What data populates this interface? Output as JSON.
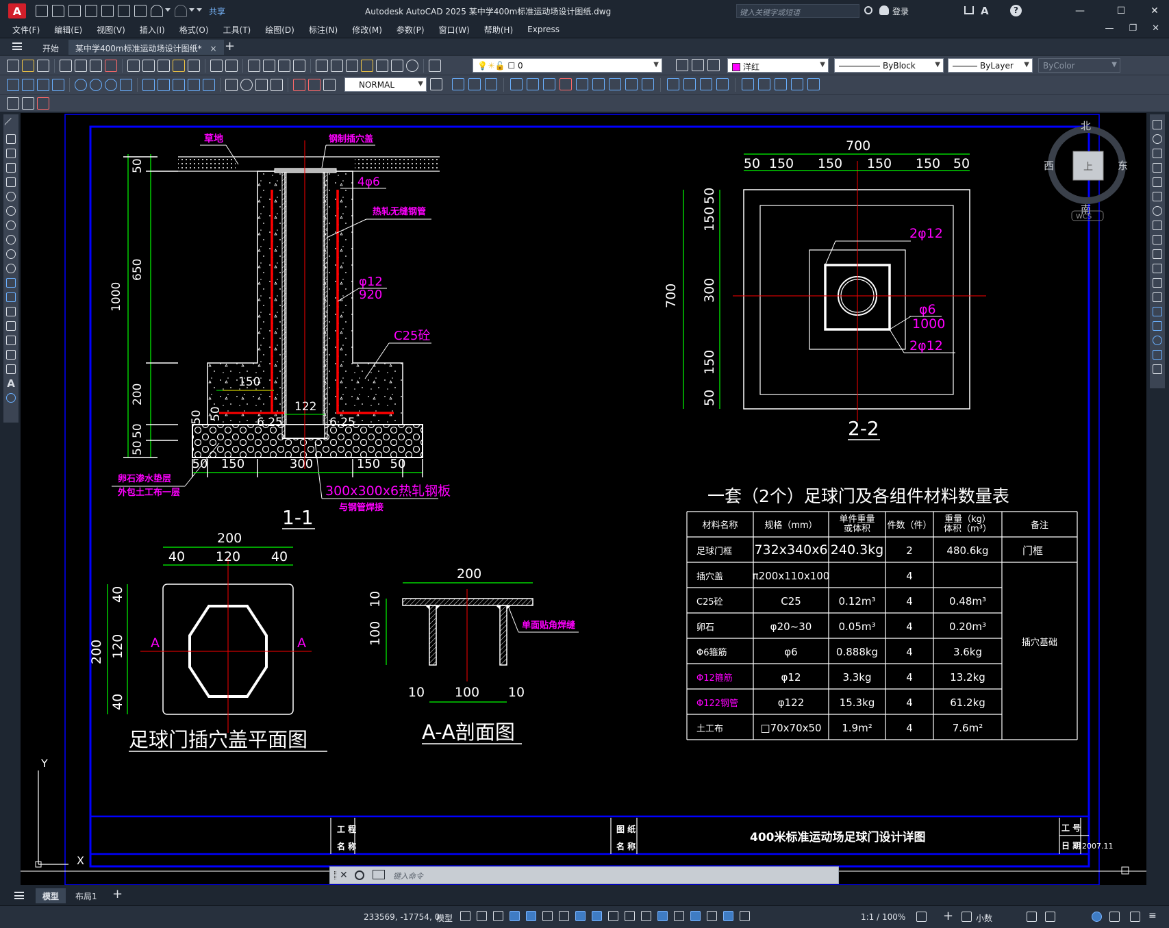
{
  "app": {
    "logo": "A",
    "title": "Autodesk AutoCAD 2025    某中学400m标准运动场设计图纸.dwg",
    "share_label": "共享",
    "search_placeholder": "键入关键字或短语",
    "login_label": "登录"
  },
  "menu": [
    "文件(F)",
    "编辑(E)",
    "视图(V)",
    "插入(I)",
    "格式(O)",
    "工具(T)",
    "绘图(D)",
    "标注(N)",
    "修改(M)",
    "参数(P)",
    "窗口(W)",
    "帮助(H)",
    "Express"
  ],
  "tabs": {
    "start": "开始",
    "drawing": "某中学400m标准运动场设计图纸*",
    "close": "×",
    "add": "+"
  },
  "toolbar": {
    "layer_value": "0",
    "color_value": "洋红",
    "linetype_value": "ByBlock",
    "lineweight_value": "ByLayer",
    "plotstyle_value": "ByColor",
    "dimstyle_value": "NORMAL"
  },
  "viewcube": {
    "north": "北",
    "south": "南",
    "east": "东",
    "west": "西",
    "face": "上",
    "wcs": "WCS"
  },
  "ucs": {
    "y": "Y",
    "x": "X"
  },
  "drawing": {
    "section11": {
      "title": "1-1",
      "label_grass": "草地",
      "label_cover": "钢制插穴盖",
      "label_4phi6": "4φ6",
      "label_pipe": "热轧无缝钢管",
      "label_phi12": "φ12",
      "label_920": "920",
      "label_c25": "C25砼",
      "label_gravel1": "卵石渗水垫层",
      "label_gravel2": "外包土工布一层",
      "label_plate1": "300x300x6热轧钢板",
      "label_plate2": "与钢管焊接",
      "dim_1000": "1000",
      "dim_50a": "50",
      "dim_650": "650",
      "dim_200": "200",
      "dim_50b": "50",
      "dim_50c": "50",
      "dim_50d": "50",
      "dim_150in": "150",
      "dim_122": "122",
      "dim_625a": "6.25",
      "dim_625b": "6.25",
      "dim_50e": "50",
      "bottom_dims": [
        "50",
        "150",
        "300",
        "150",
        "50"
      ]
    },
    "section22": {
      "title": "2-2",
      "dim_700_top": "700",
      "top_dims": [
        "50",
        "150",
        "150",
        "150",
        "150",
        "50"
      ],
      "dim_700_left": "700",
      "left_dims": [
        "50",
        "150",
        "300",
        "150",
        "50"
      ],
      "label_2phi12a": "2φ12",
      "label_phi6": "φ6",
      "label_1000": "1000",
      "label_2phi12b": "2φ12"
    },
    "cover_plan": {
      "title": "足球门插穴盖平面图",
      "dim_200_top": "200",
      "top_dims": [
        "40",
        "120",
        "40"
      ],
      "dim_200_left": "200",
      "left_dims": [
        "40",
        "120",
        "40"
      ],
      "mark_a": "A"
    },
    "aa_section": {
      "title": "A-A剖面图",
      "dim_200": "200",
      "dim_10": "10",
      "dim_100": "100",
      "bottom_dims": [
        "10",
        "100",
        "10"
      ],
      "label_weld": "单面贴角焊缝"
    },
    "table": {
      "title": "一套（2个）足球门及各组件材料数量表",
      "headers": [
        "材料名称",
        "规格（mm）",
        "单件重量\n或体积",
        "件数（件）",
        "重量（kg）\n体积（m³）",
        "备注"
      ],
      "rows": [
        [
          "足球门框",
          "732x340x6",
          "240.3kg",
          "2",
          "480.6kg",
          "门框"
        ],
        [
          "插穴盖",
          "π200x110x100",
          "",
          "4",
          "",
          ""
        ],
        [
          "C25砼",
          "C25",
          "0.12m³",
          "4",
          "0.48m³",
          ""
        ],
        [
          "卵石",
          "φ20~30",
          "0.05m³",
          "4",
          "0.20m³",
          ""
        ],
        [
          "Φ6箍筋",
          "φ6",
          "0.888kg",
          "4",
          "3.6kg",
          ""
        ],
        [
          "Φ12箍筋",
          "φ12",
          "3.3kg",
          "4",
          "13.2kg",
          ""
        ],
        [
          "Φ122钢管",
          "φ122",
          "15.3kg",
          "4",
          "61.2kg",
          ""
        ],
        [
          "土工布",
          "□70x70x50",
          "1.9m²",
          "4",
          "7.6m²",
          ""
        ]
      ],
      "remark_base": "插穴基础"
    },
    "titleblock": {
      "proj_label_1": "工 程",
      "proj_label_2": "名 称",
      "draw_label_1": "图 纸",
      "draw_label_2": "名 称",
      "drawing_name": "400米标准运动场足球门设计详图",
      "job_label": "工 号",
      "date_label": "日 期",
      "date_value": "2007.11"
    },
    "colors": {
      "magenta": "#ff00ff",
      "green": "#00ff00",
      "red": "#ff0000",
      "blue": "#0000ff",
      "white": "#ffffff"
    }
  },
  "command": {
    "placeholder": "键入命令"
  },
  "layout_tabs": {
    "model": "模型",
    "layout1": "布局1",
    "add": "+"
  },
  "status": {
    "coords": "233569, -17754, 0",
    "model": "模型",
    "scale": "1:1 / 100%",
    "units": "小数"
  }
}
